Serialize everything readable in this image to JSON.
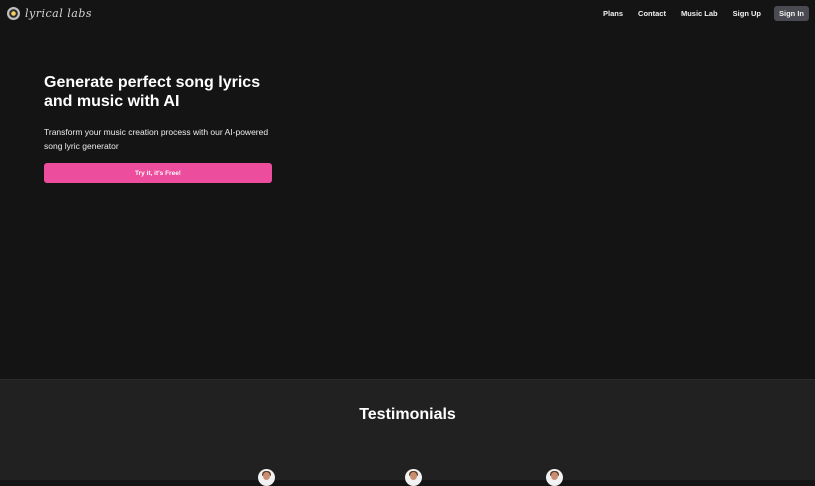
{
  "header": {
    "logo_text": "lyrical labs",
    "nav": {
      "plans": "Plans",
      "contact": "Contact",
      "music_lab": "Music Lab",
      "sign_up": "Sign Up",
      "sign_in": "Sign In"
    }
  },
  "hero": {
    "title": "Generate perfect song lyrics and music with AI",
    "subtitle": "Transform your music creation process with our AI-powered song lyric generator",
    "cta_label": "Try it, it's Free!"
  },
  "testimonials": {
    "title": "Testimonials"
  },
  "colors": {
    "background": "#151414",
    "cta": "#ec4d9c",
    "section_bg": "#222121",
    "sign_in_bg": "#4a4a52"
  }
}
